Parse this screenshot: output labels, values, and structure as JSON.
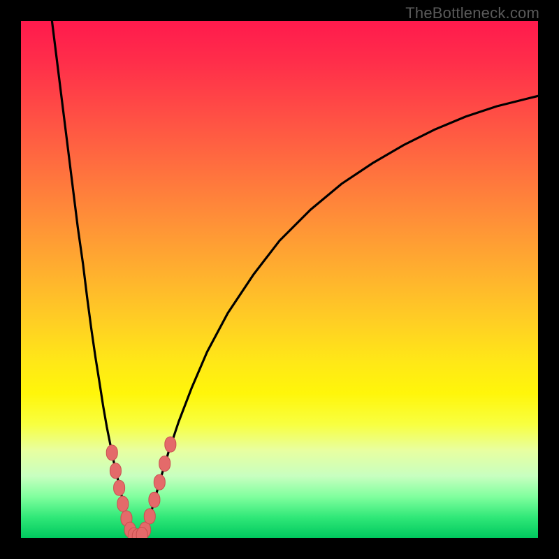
{
  "watermark": "TheBottleneck.com",
  "chart_data": {
    "type": "line",
    "title": "",
    "xlabel": "",
    "ylabel": "",
    "xlim": [
      0,
      100
    ],
    "ylim": [
      0,
      100
    ],
    "grid": false,
    "legend": false,
    "background": "spectral-gradient vertical (red top → green bottom)",
    "series": [
      {
        "name": "left-branch",
        "x": [
          6,
          7,
          8,
          9,
          10,
          11,
          12,
          12.8,
          13.6,
          14.4,
          15.2,
          15.9,
          16.6,
          17.3,
          18.0,
          18.7,
          19.4,
          20.1,
          20.8
        ],
        "y": [
          100,
          92,
          84,
          76,
          68,
          60,
          53,
          46.5,
          40.5,
          35,
          30,
          25.5,
          21.5,
          18,
          14.5,
          11.5,
          8.5,
          5.5,
          2.5
        ]
      },
      {
        "name": "valley-floor",
        "x": [
          20.8,
          21.4,
          22.0,
          22.6,
          23.2,
          23.8,
          24.4
        ],
        "y": [
          2.5,
          1.2,
          0.5,
          0.3,
          0.5,
          1.1,
          2.4
        ]
      },
      {
        "name": "right-branch",
        "x": [
          24.4,
          25.6,
          27.0,
          28.5,
          30.5,
          33,
          36,
          40,
          45,
          50,
          56,
          62,
          68,
          74,
          80,
          86,
          92,
          98,
          100
        ],
        "y": [
          2.4,
          6.5,
          11.5,
          16.5,
          22.5,
          29,
          36,
          43.5,
          51,
          57.5,
          63.5,
          68.5,
          72.5,
          76,
          79,
          81.5,
          83.5,
          85,
          85.5
        ]
      }
    ],
    "annotations": [
      {
        "name": "beads-left",
        "type": "scatter",
        "shape": "rounded-rect",
        "color": "#e46a6a",
        "x": [
          17.6,
          18.3,
          19.0,
          19.7,
          20.4,
          21.1
        ],
        "y": [
          16.5,
          13.0,
          9.7,
          6.6,
          3.8,
          1.6
        ]
      },
      {
        "name": "beads-right",
        "type": "scatter",
        "shape": "rounded-rect",
        "color": "#e46a6a",
        "x": [
          24.0,
          24.9,
          25.8,
          26.8,
          27.8,
          28.9
        ],
        "y": [
          1.6,
          4.2,
          7.4,
          10.8,
          14.4,
          18.1
        ]
      },
      {
        "name": "beads-bottom",
        "type": "scatter",
        "shape": "rounded-rect",
        "color": "#e46a6a",
        "x": [
          21.8,
          22.6,
          23.4
        ],
        "y": [
          0.5,
          0.3,
          0.6
        ]
      }
    ]
  }
}
